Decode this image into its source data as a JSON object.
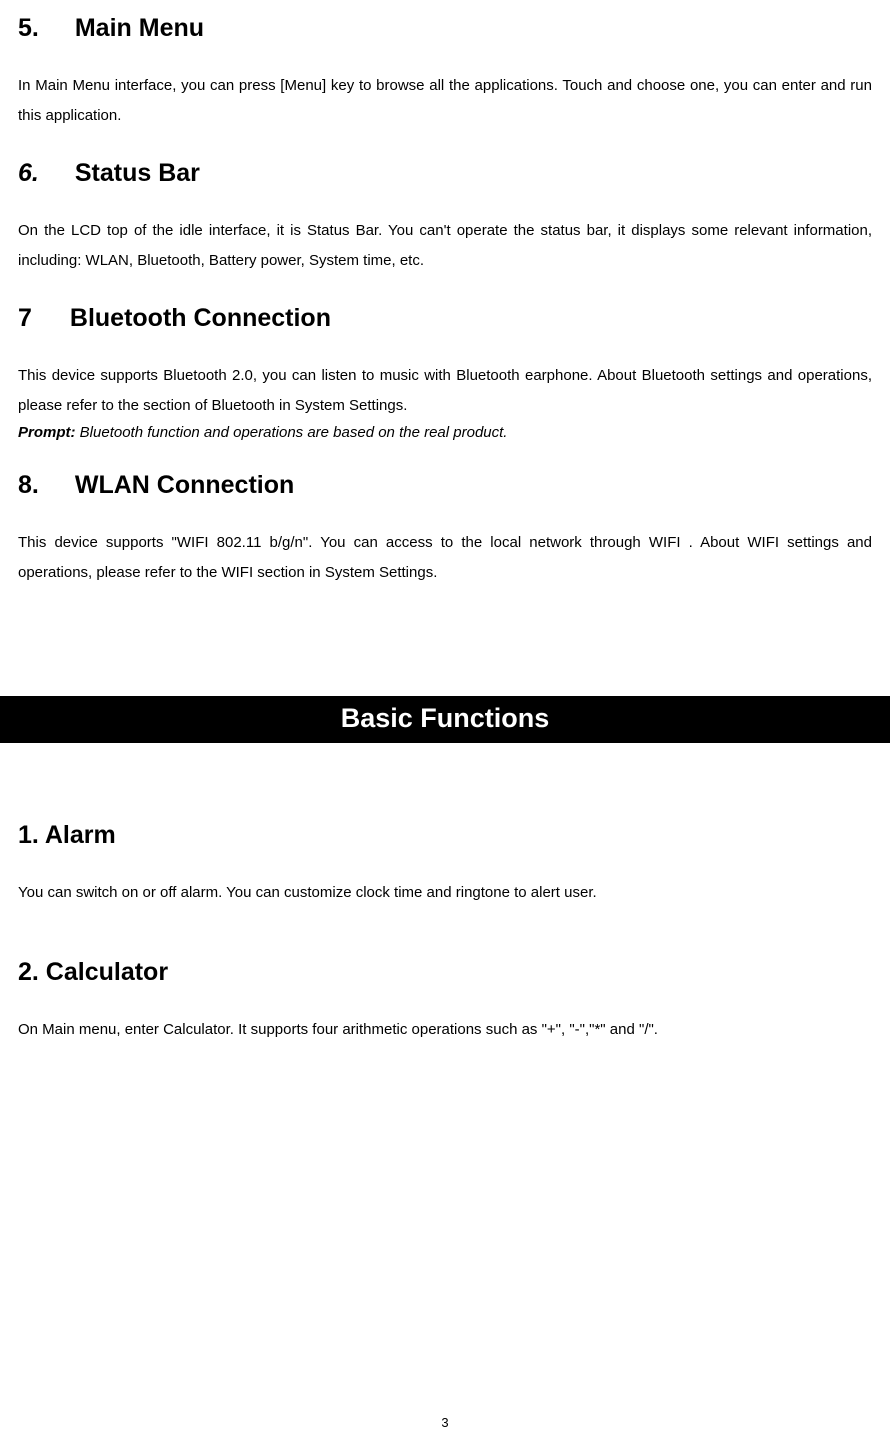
{
  "section5": {
    "num": "5.",
    "title": "Main Menu",
    "body": "In Main Menu interface, you can press [Menu] key to browse all the applications. Touch and choose one, you can enter and run this application."
  },
  "section6": {
    "num": "6.",
    "title": "Status Bar",
    "body": "On the LCD top of the idle interface, it is Status Bar. You can't operate the status bar, it displays some relevant information, including: WLAN, Bluetooth, Battery power, System time, etc."
  },
  "section7": {
    "num": "7",
    "title": "Bluetooth Connection",
    "body": "This device supports Bluetooth 2.0, you can listen to music with Bluetooth earphone. About Bluetooth settings and operations, please refer to the section of Bluetooth in System Settings.",
    "prompt_label": "Prompt:",
    "prompt_text": " Bluetooth function and operations are based on the real product."
  },
  "section8": {
    "num": "8.",
    "title": "WLAN Connection",
    "body": "This device supports \"WIFI 802.11 b/g/n\". You can access to the local network through WIFI . About WIFI settings and operations, please refer to the WIFI section in System Settings."
  },
  "banner": "Basic Functions",
  "alarm": {
    "title": "1. Alarm",
    "body": "You can switch on or off alarm. You can customize clock time and ringtone to alert user."
  },
  "calculator": {
    "title": "2. Calculator",
    "body": "On Main menu, enter Calculator. It supports four arithmetic operations such as \"+\", \"-\",\"*\" and \"/\"."
  },
  "page_number": "3"
}
